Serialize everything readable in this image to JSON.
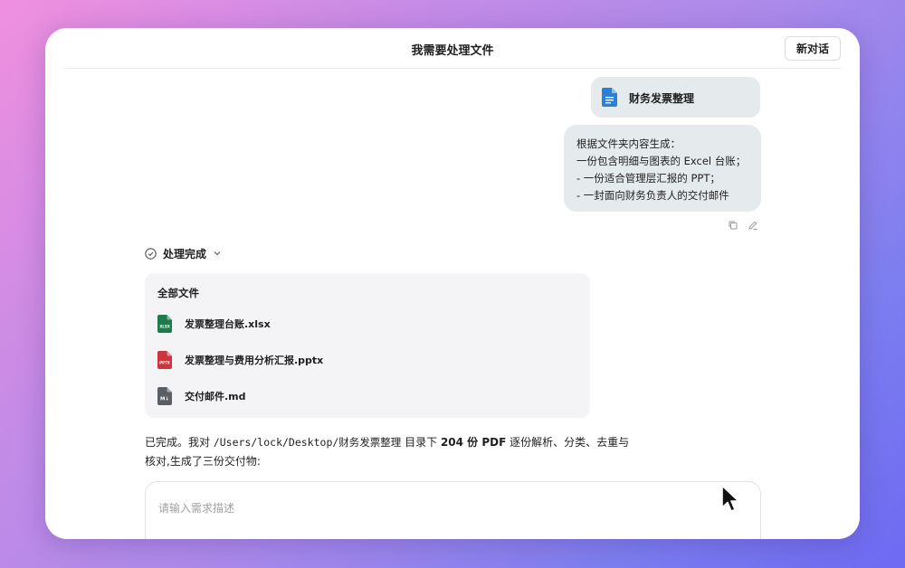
{
  "header": {
    "title": "我需要处理文件",
    "new_chat_label": "新对话"
  },
  "user": {
    "attachment_name": "财务发票整理",
    "message_lines": [
      "根据文件夹内容生成：",
      "一份包含明细与图表的 Excel 台账；",
      "- 一份适合管理层汇报的 PPT；",
      "- 一封面向财务负责人的交付邮件"
    ]
  },
  "status": {
    "label": "处理完成"
  },
  "files": {
    "title": "全部文件",
    "items": [
      {
        "name": "发票整理台账.xlsx",
        "icon": "xlsx-file-icon",
        "badge": "XLSX",
        "color": "#1f7a4c"
      },
      {
        "name": "发票整理与费用分析汇报.pptx",
        "icon": "pptx-file-icon",
        "badge": "PPTX",
        "color": "#c9363e"
      },
      {
        "name": "交付邮件.md",
        "icon": "md-file-icon",
        "badge": "M↓",
        "color": "#5a5f66"
      }
    ]
  },
  "answer": {
    "part1": "已完成。我对 ",
    "path": "/Users/lock/Desktop/财务发票整理",
    "part2": " 目录下 ",
    "count": "204 份 PDF",
    "part3": " 逐份解析、分类、去重与",
    "line2": "核对,生成了三份交付物:"
  },
  "input": {
    "placeholder": "请输入需求描述"
  },
  "colors": {
    "bubble": "#e5eaec",
    "card": "#f4f4f6",
    "doc_blue": "#2b7fd4"
  }
}
